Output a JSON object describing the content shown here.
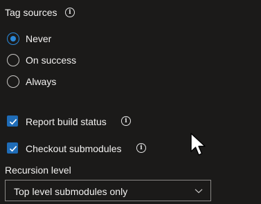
{
  "tag_sources": {
    "title": "Tag sources",
    "options": [
      {
        "label": "Never",
        "selected": true
      },
      {
        "label": "On success",
        "selected": false
      },
      {
        "label": "Always",
        "selected": false
      }
    ]
  },
  "checkboxes": {
    "report_build_status": {
      "label": "Report build status",
      "checked": true
    },
    "checkout_submodules": {
      "label": "Checkout submodules",
      "checked": true
    }
  },
  "recursion": {
    "label": "Recursion level",
    "value": "Top level submodules only"
  },
  "icons": {
    "info": "info-icon",
    "check": "checkmark-icon",
    "chevron": "chevron-down-icon",
    "cursor": "mouse-pointer-icon"
  },
  "colors": {
    "background": "#1b1a19",
    "accent": "#2b88d8",
    "checkbox_fill": "#1f6cb7",
    "text": "#f3f2f1",
    "border": "#8a8886"
  }
}
